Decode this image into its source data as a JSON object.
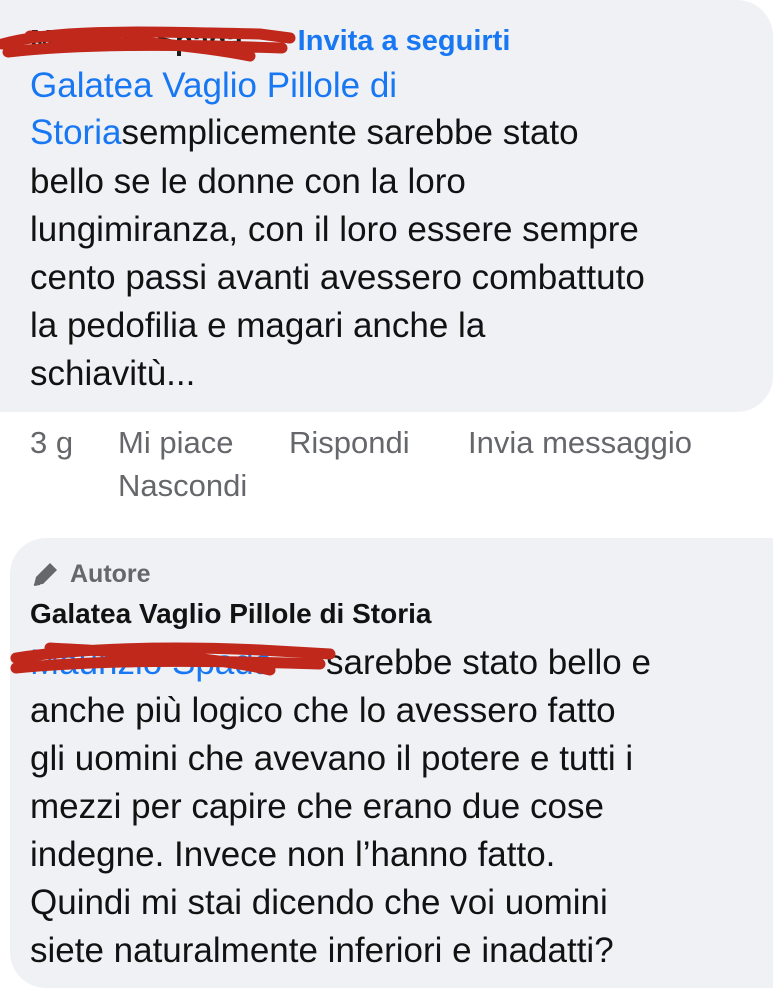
{
  "comment1": {
    "author_name": "Maurizio Spada",
    "separator": "·",
    "invite_label": "Invita a seguirti",
    "mention": "Galatea Vaglio Pillole di",
    "mention_cont": "Storia",
    "line2_rest": "semplicemente sarebbe stato",
    "line3": "bello se le donne con la loro",
    "line4": "lungimiranza, con il loro essere sempre",
    "line5": "cento passi avanti avessero combattuto",
    "line6": "la pedofilia e magari anche la",
    "line7": "schiavitù..."
  },
  "actions": {
    "time": "3 g",
    "like": "Mi piace",
    "reply": "Rispondi",
    "message": "Invia messaggio",
    "hide": "Nascondi"
  },
  "comment2": {
    "badge": "Autore",
    "author_name": "Galatea Vaglio Pillole di Storia",
    "mention": "Maurizio Spada",
    "line1_rest": "sarebbe stato bello e",
    "line2": "anche più logico che lo avessero fatto",
    "line3": "gli uomini che avevano il potere e tutti i",
    "line4": "mezzi per capire che erano due cose",
    "line5": "indegne. Invece non l’hanno fatto.",
    "line6": "Quindi mi stai dicendo che voi uomini",
    "line7": "siete naturalmente inferiori e inadatti?"
  },
  "colors": {
    "bubble": "#f0f1f5",
    "link": "#1877f2",
    "text": "#121212",
    "secondary": "#65676b",
    "redaction": "#c0281b"
  }
}
